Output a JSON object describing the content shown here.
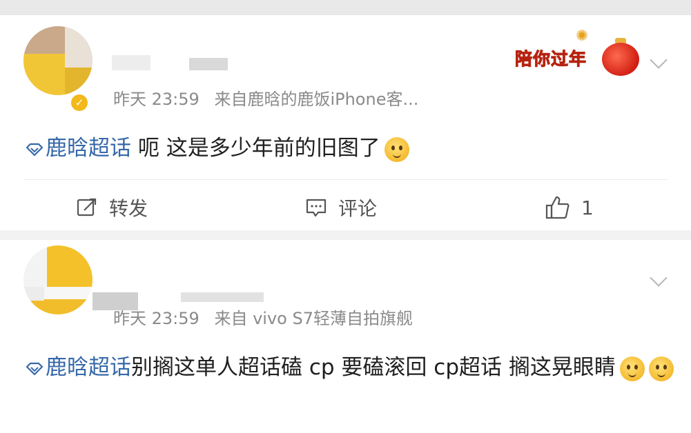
{
  "posts": [
    {
      "meta": {
        "time_day": "昨天",
        "time": "23:59",
        "source": "来自鹿晗的鹿饭iPhone客..."
      },
      "promo_label": "陪你过年",
      "text": {
        "topic": "鹿晗超话",
        "body": " 呃 这是多少年前的旧图了"
      },
      "emoji": "thinking-face",
      "actions": {
        "repost": "转发",
        "comment": "评论",
        "like_count": "1"
      }
    },
    {
      "meta": {
        "time_day": "昨天",
        "time": "23:59",
        "source": "来自 vivo S7轻薄自拍旗舰"
      },
      "text": {
        "topic": "鹿晗超话",
        "body": "别搁这单人超话磕 cp 要磕滚回 cp超话 搁这晃眼睛"
      },
      "emojis": [
        "blushing-face",
        "blushing-face"
      ]
    }
  ],
  "colors": {
    "topic": "#3568a8",
    "meta": "#8a8a8a",
    "promo": "#d4321e",
    "verified": "#f3b81c"
  }
}
